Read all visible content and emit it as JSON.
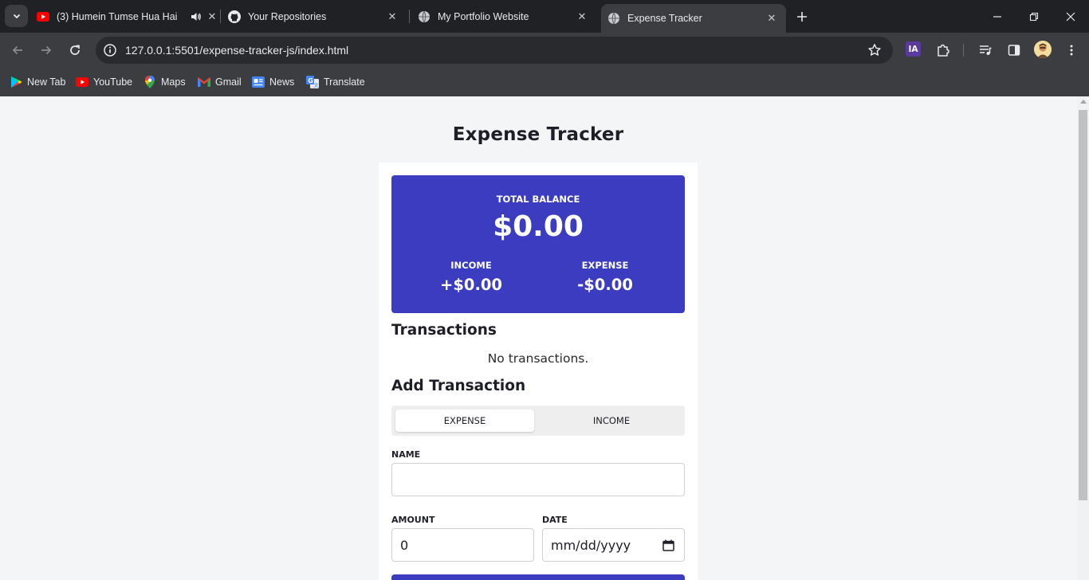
{
  "browser": {
    "tabs": [
      {
        "title": "(3) Humein Tumse Hua Hai",
        "icon": "youtube-icon",
        "audio": true,
        "active": false
      },
      {
        "title": "Your Repositories",
        "icon": "github-icon",
        "active": false
      },
      {
        "title": "My Portfolio Website",
        "icon": "globe-icon",
        "active": false
      },
      {
        "title": "Expense Tracker",
        "icon": "globe-icon",
        "active": true
      }
    ],
    "url_host": "127.0.0.1",
    "url_rest": ":5501/expense-tracker-js/index.html",
    "extension_badge": "IA",
    "bookmarks": [
      {
        "label": "New Tab",
        "icon": "play-store-icon"
      },
      {
        "label": "YouTube",
        "icon": "youtube-icon"
      },
      {
        "label": "Maps",
        "icon": "maps-pin-icon"
      },
      {
        "label": "Gmail",
        "icon": "gmail-icon"
      },
      {
        "label": "News",
        "icon": "news-icon"
      },
      {
        "label": "Translate",
        "icon": "translate-icon"
      }
    ]
  },
  "app": {
    "title": "Expense Tracker",
    "balance": {
      "label": "TOTAL BALANCE",
      "amount": "$0.00",
      "income_label": "INCOME",
      "income_amount": "+$0.00",
      "expense_label": "EXPENSE",
      "expense_amount": "-$0.00"
    },
    "transactions": {
      "heading": "Transactions",
      "empty_message": "No transactions."
    },
    "form": {
      "heading": "Add Transaction",
      "type_options": [
        "EXPENSE",
        "INCOME"
      ],
      "selected_type": "EXPENSE",
      "name_label": "NAME",
      "name_value": "",
      "amount_label": "AMOUNT",
      "amount_value": "0",
      "date_label": "DATE",
      "date_placeholder": "mm/dd/yyyy"
    }
  },
  "colors": {
    "accent": "#3b3cbf",
    "chrome_dark": "#202124",
    "chrome_toolbar": "#3c3d40"
  }
}
